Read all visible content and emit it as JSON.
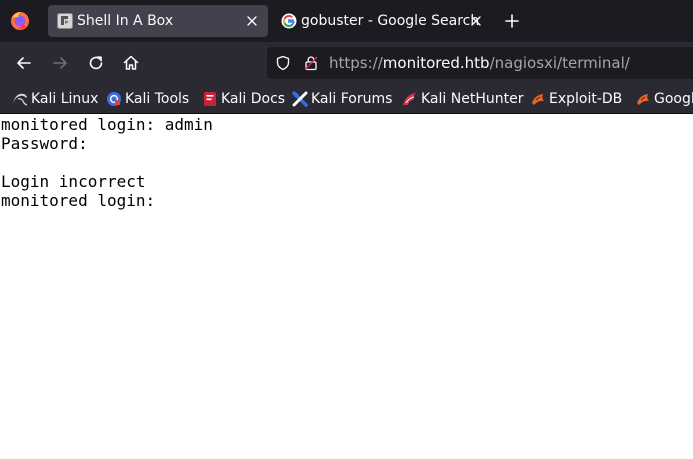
{
  "tabs": [
    {
      "title": "Shell In A Box",
      "active": true
    },
    {
      "title": "gobuster - Google Search",
      "active": false
    }
  ],
  "url": {
    "scheme": "https://",
    "host": "monitored.htb",
    "path": "/nagiosxi/terminal/"
  },
  "bookmarks": [
    {
      "label": "Kali Linux",
      "icon": "kali-dragon-icon"
    },
    {
      "label": "Kali Tools",
      "icon": "kali-tools-icon"
    },
    {
      "label": "Kali Docs",
      "icon": "kali-docs-icon"
    },
    {
      "label": "Kali Forums",
      "icon": "kali-forums-icon"
    },
    {
      "label": "Kali NetHunter",
      "icon": "kali-nethunter-icon"
    },
    {
      "label": "Exploit-DB",
      "icon": "exploit-db-icon"
    },
    {
      "label": "Google Hacking DB",
      "icon": "ghdb-icon"
    }
  ],
  "terminal": {
    "lines": [
      "monitored login: admin",
      "Password:",
      "",
      "Login incorrect",
      "monitored login:"
    ]
  },
  "colors": {
    "tabstrip": "#1c1b22",
    "toolbar": "#2b2a33",
    "active_tab": "#42414d",
    "terminal_bg": "#ffffff",
    "terminal_fg": "#000000"
  }
}
